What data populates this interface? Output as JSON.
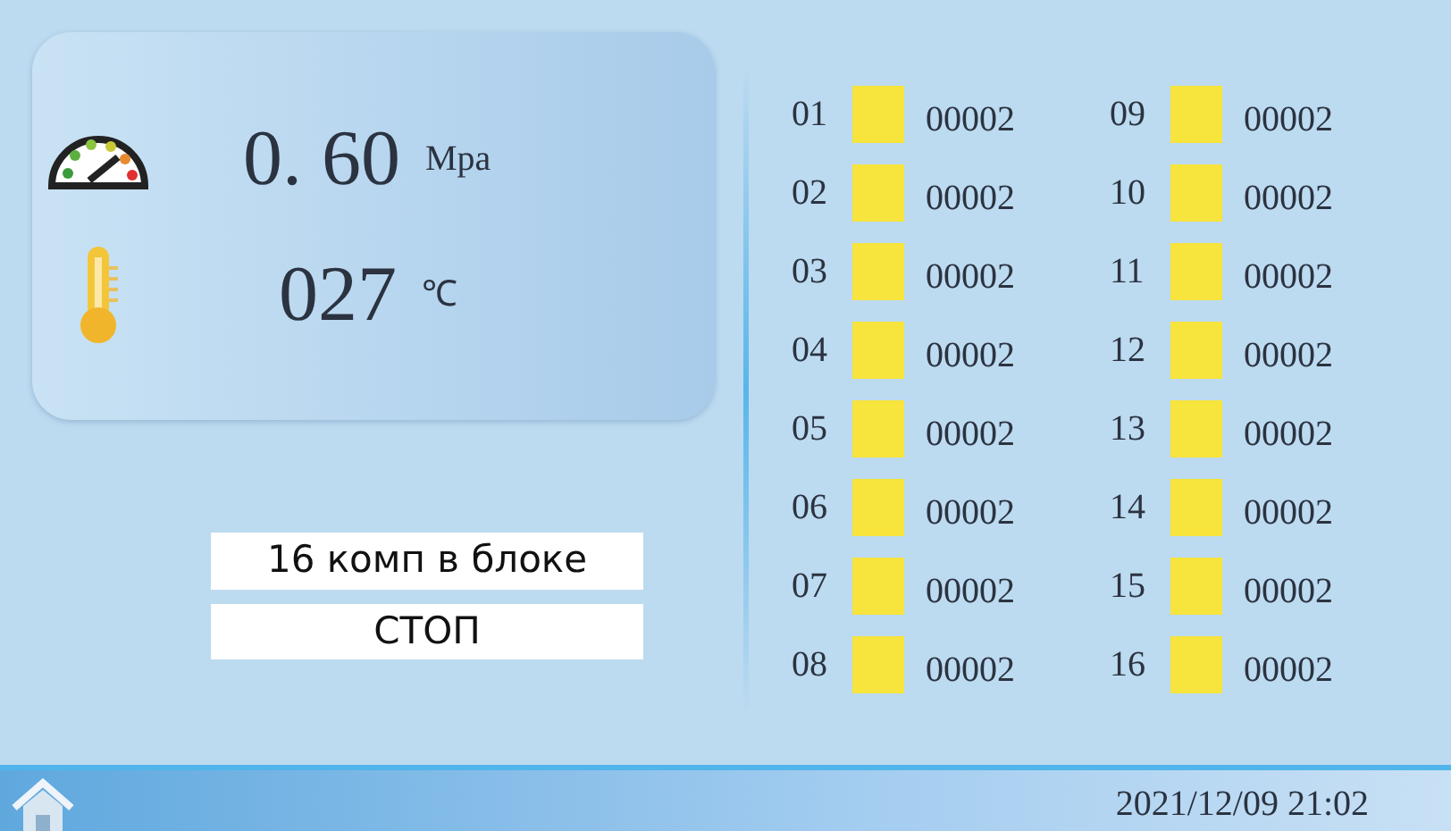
{
  "readings": [
    {
      "kind": "pressure",
      "value": "0. 60",
      "unit": "Mpa"
    },
    {
      "kind": "temperature",
      "value": "027",
      "unit": "℃"
    }
  ],
  "block_label": "16 комп в блоке",
  "status": "СТОП",
  "compartments": [
    {
      "number": "01",
      "color": "#f7e43c",
      "count": "00002"
    },
    {
      "number": "02",
      "color": "#f7e43c",
      "count": "00002"
    },
    {
      "number": "03",
      "color": "#f7e43c",
      "count": "00002"
    },
    {
      "number": "04",
      "color": "#f7e43c",
      "count": "00002"
    },
    {
      "number": "05",
      "color": "#f7e43c",
      "count": "00002"
    },
    {
      "number": "06",
      "color": "#f7e43c",
      "count": "00002"
    },
    {
      "number": "07",
      "color": "#f7e43c",
      "count": "00002"
    },
    {
      "number": "08",
      "color": "#f7e43c",
      "count": "00002"
    },
    {
      "number": "09",
      "color": "#f7e43c",
      "count": "00002"
    },
    {
      "number": "10",
      "color": "#f7e43c",
      "count": "00002"
    },
    {
      "number": "11",
      "color": "#f7e43c",
      "count": "00002"
    },
    {
      "number": "12",
      "color": "#f7e43c",
      "count": "00002"
    },
    {
      "number": "13",
      "color": "#f7e43c",
      "count": "00002"
    },
    {
      "number": "14",
      "color": "#f7e43c",
      "count": "00002"
    },
    {
      "number": "15",
      "color": "#f7e43c",
      "count": "00002"
    },
    {
      "number": "16",
      "color": "#f7e43c",
      "count": "00002"
    }
  ],
  "status_bar": {
    "datetime": "2021/12/09 21:02"
  }
}
